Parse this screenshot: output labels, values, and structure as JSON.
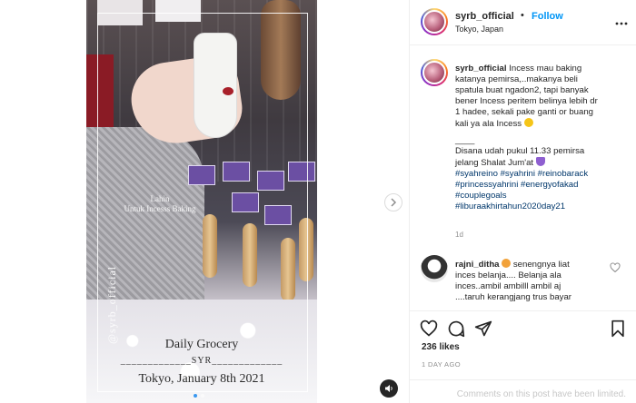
{
  "post": {
    "username": "syrb_official",
    "separator": "•",
    "follow_label": "Follow",
    "location": "Tokyo, Japan",
    "more_icon": "more-horizontal-icon"
  },
  "media": {
    "overlay_label_line1": "Lahin",
    "overlay_label_line2": "Untuk Incesss Baking",
    "vertical_handle": "@syrb_official",
    "caption_title": "Daily Grocery",
    "caption_line": "_____________SYR_____________",
    "caption_date": "Tokyo, January 8th 2021",
    "carousel_count": 2,
    "carousel_active": 0,
    "next_icon": "chevron-right-icon",
    "sound_icon": "speaker-icon"
  },
  "caption": {
    "username": "syrb_official",
    "text_lines": [
      "Incess mau baking",
      "katanya pemirsa,..makanya beli",
      "spatula buat ngadon2, tapi banyak",
      "bener Incess peritem belinya lebih dr",
      "1 hadee, sekali pake ganti or buang",
      "kali ya ala Incess"
    ],
    "divider": "____",
    "note_line1": "Disana udah pukul 11.33 pemirsa",
    "note_line2": "jelang Shalat Jum'at",
    "hashtags": [
      "#syahreino #syahrini #reinobarack",
      "#princessyahrini #energyofakad",
      "#couplegoals",
      "#liburaakhirtahun2020day21"
    ],
    "time_ago": "1d"
  },
  "comments": [
    {
      "username": "rajni_ditha",
      "text_line1": "senengnya liat",
      "text_line2": "inces belanja.... Belanja ala",
      "text_line3": "inces..ambil ambilll ambil aj",
      "text_line4": "....taruh kerangjang trus bayar"
    }
  ],
  "actions": {
    "like_icon": "heart-icon",
    "comment_icon": "comment-icon",
    "share_icon": "send-icon",
    "save_icon": "bookmark-icon"
  },
  "likes": "236 likes",
  "posted": "1 DAY AGO",
  "footer": {
    "limited_text": "Comments on this post have been limited."
  },
  "colors": {
    "accent_blue": "#0095f6",
    "hashtag_blue": "#00376b",
    "muted_gray": "#8e8e8e",
    "border_gray": "#efefef"
  }
}
